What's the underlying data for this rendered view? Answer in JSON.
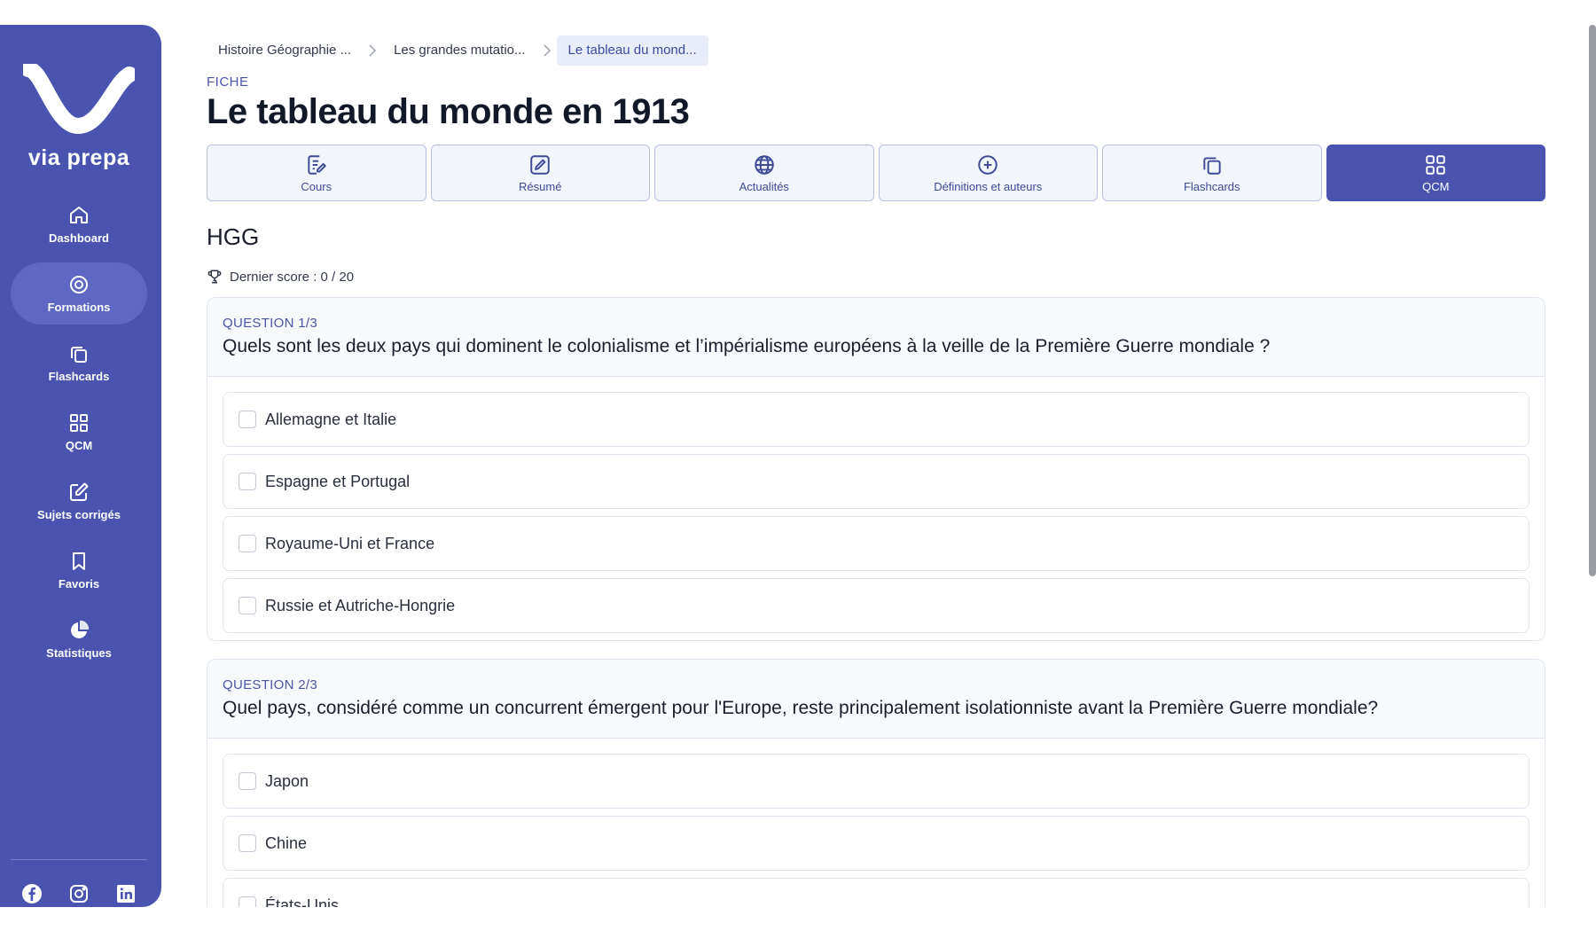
{
  "brand": {
    "name": "via prepa"
  },
  "sidebar": {
    "items": [
      {
        "label": "Dashboard",
        "icon": "home-icon"
      },
      {
        "label": "Formations",
        "icon": "target-icon"
      },
      {
        "label": "Flashcards",
        "icon": "copy-icon"
      },
      {
        "label": "QCM",
        "icon": "grid-icon"
      },
      {
        "label": "Sujets corrigés",
        "icon": "edit-icon"
      },
      {
        "label": "Favoris",
        "icon": "bookmark-icon"
      },
      {
        "label": "Statistiques",
        "icon": "pie-chart-icon"
      }
    ],
    "active": "Formations",
    "socials": [
      "facebook-icon",
      "instagram-icon",
      "linkedin-icon"
    ]
  },
  "breadcrumb": [
    "Histoire Géographie ...",
    "Les grandes mutatio...",
    "Le tableau du mond..."
  ],
  "eyebrow": "FICHE",
  "title": "Le tableau du monde en 1913",
  "tabs": [
    {
      "label": "Cours",
      "icon": "note-icon"
    },
    {
      "label": "Résumé",
      "icon": "pen-square-icon"
    },
    {
      "label": "Actualités",
      "icon": "globe-icon"
    },
    {
      "label": "Définitions et auteurs",
      "icon": "plus-circle-icon"
    },
    {
      "label": "Flashcards",
      "icon": "copy-icon"
    },
    {
      "label": "QCM",
      "icon": "grid-icon"
    }
  ],
  "active_tab": "QCM",
  "subject": "HGG",
  "score": "Dernier score : 0 / 20",
  "questions": [
    {
      "number": "QUESTION 1/3",
      "text": "Quels sont les deux pays qui dominent le colonialisme et l’impérialisme européens à la veille de la Première Guerre mondiale ?",
      "answers": [
        "Allemagne et Italie",
        "Espagne et Portugal",
        "Royaume-Uni et France",
        "Russie et Autriche-Hongrie"
      ]
    },
    {
      "number": "QUESTION 2/3",
      "text": "Quel pays, considéré comme un concurrent émergent pour l'Europe, reste principalement isolationniste avant la Première Guerre mondiale?",
      "answers": [
        "Japon",
        "Chine",
        "États-Unis"
      ]
    }
  ],
  "colors": {
    "primary": "#4a53b0",
    "accent_text": "#4a55a8",
    "tab_bg": "#f2f5fc"
  }
}
